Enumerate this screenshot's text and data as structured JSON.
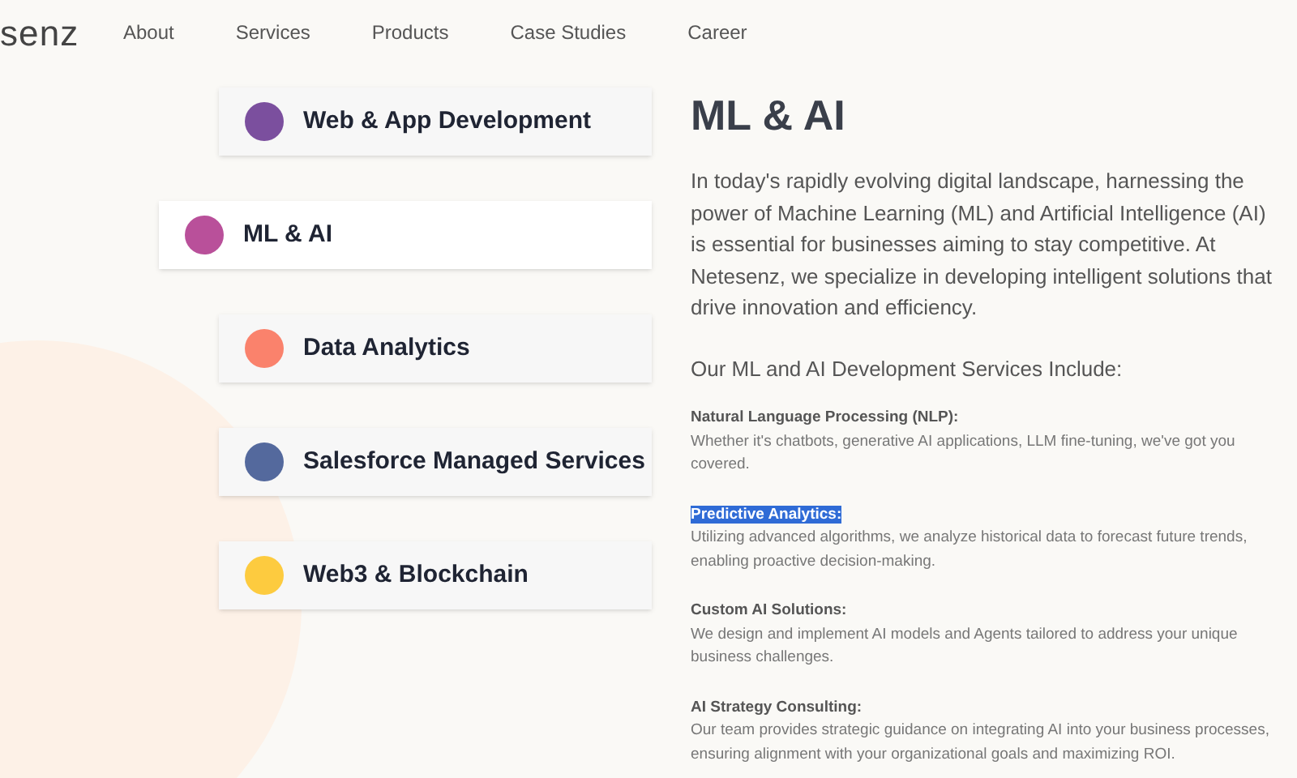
{
  "header": {
    "logo": "senz",
    "nav": [
      "About",
      "Services",
      "Products",
      "Case Studies",
      "Career"
    ]
  },
  "categories": [
    {
      "label": "Web & App Development",
      "color": "#7b4f9e",
      "selected": false
    },
    {
      "label": "ML & AI",
      "color": "#b9509a",
      "selected": true
    },
    {
      "label": "Data Analytics",
      "color": "#fa826c",
      "selected": false
    },
    {
      "label": "Salesforce Managed Services",
      "color": "#54699d",
      "selected": false
    },
    {
      "label": "Web3 & Blockchain",
      "color": "#fdcb3f",
      "selected": false
    }
  ],
  "content": {
    "title": "ML & AI",
    "intro": "In today's rapidly evolving digital landscape, harnessing the power of Machine Learning (ML) and Artificial Intelligence (AI) is essential for businesses aiming to stay competitive. At Netesenz, we specialize in developing intelligent solutions that drive innovation and efficiency.",
    "subtitle": "Our ML and AI Development Services Include:",
    "services": [
      {
        "heading": "Natural Language Processing (NLP):",
        "text": "Whether it's chatbots, generative AI applications, LLM fine-tuning, we've got you covered.",
        "highlighted": false
      },
      {
        "heading": "Predictive Analytics:",
        "text": "Utilizing advanced algorithms, we analyze historical data to forecast future trends, enabling proactive decision-making.",
        "highlighted": true
      },
      {
        "heading": "Custom AI Solutions:",
        "text": "We design and implement AI models and Agents tailored to address your unique business challenges.",
        "highlighted": false
      },
      {
        "heading": "AI Strategy Consulting:",
        "text": "Our team provides strategic guidance on integrating AI into your business processes, ensuring alignment with your organizational goals and maximizing ROI.",
        "highlighted": false
      }
    ]
  }
}
